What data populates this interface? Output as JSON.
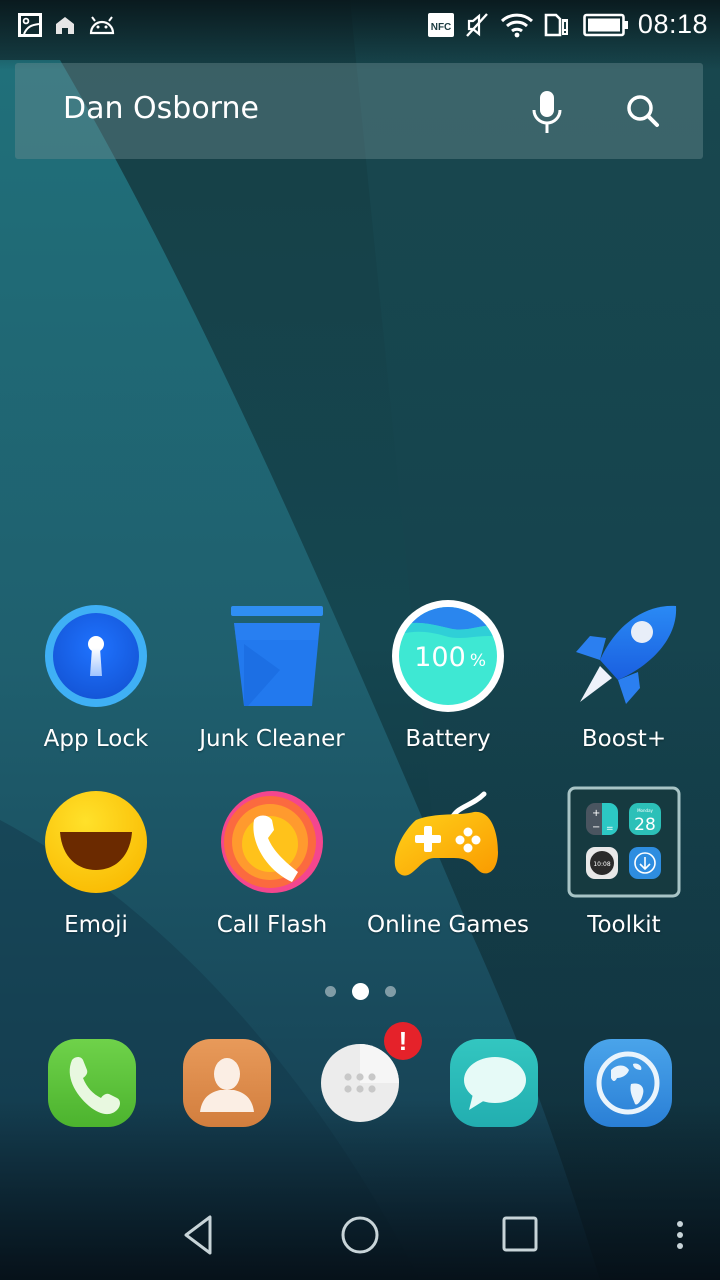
{
  "status_bar": {
    "left_icons": [
      "image-icon",
      "home-icon",
      "android-icon"
    ],
    "right_icons": [
      "nfc-icon",
      "vibrate-off-icon",
      "wifi-icon",
      "sim-alert-icon",
      "battery-icon"
    ],
    "nfc_label": "NFC",
    "time": "08:18"
  },
  "search": {
    "text": "Dan Osborne",
    "mic_icon": "microphone-icon",
    "search_icon": "search-icon"
  },
  "apps": [
    {
      "label": "App Lock",
      "icon": "keyhole-icon"
    },
    {
      "label": "Junk Cleaner",
      "icon": "trash-bin-icon"
    },
    {
      "label": "Battery",
      "icon": "battery-level-icon",
      "value": "100",
      "unit": "%"
    },
    {
      "label": "Boost+",
      "icon": "rocket-icon"
    },
    {
      "label": "Emoji",
      "icon": "smiley-icon"
    },
    {
      "label": "Call Flash",
      "icon": "phone-flash-icon"
    },
    {
      "label": "Online Games",
      "icon": "gamepad-icon"
    },
    {
      "label": "Toolkit",
      "icon": "folder-icon",
      "folder": {
        "calendar_day": "28",
        "calendar_weekday": "Monday",
        "clock_time": "10:08"
      }
    }
  ],
  "page_indicator": {
    "count": 3,
    "active": 2
  },
  "dock": [
    {
      "name": "Phone",
      "icon": "phone-icon"
    },
    {
      "name": "Contacts",
      "icon": "contact-icon"
    },
    {
      "name": "App Drawer",
      "icon": "app-drawer-icon",
      "badge": "!"
    },
    {
      "name": "Messages",
      "icon": "message-icon"
    },
    {
      "name": "Browser",
      "icon": "globe-icon"
    }
  ],
  "nav": {
    "back": "back-icon",
    "home": "home-circle-icon",
    "recents": "recents-icon",
    "menu": "more-vertical-icon"
  },
  "colors": {
    "wallpaper_dark": "#15434c",
    "wallpaper_light": "#1f6270",
    "badge": "#e5222a",
    "app_lock_blue": "#1e6ef0",
    "battery_cyan": "#2fe0d0"
  }
}
